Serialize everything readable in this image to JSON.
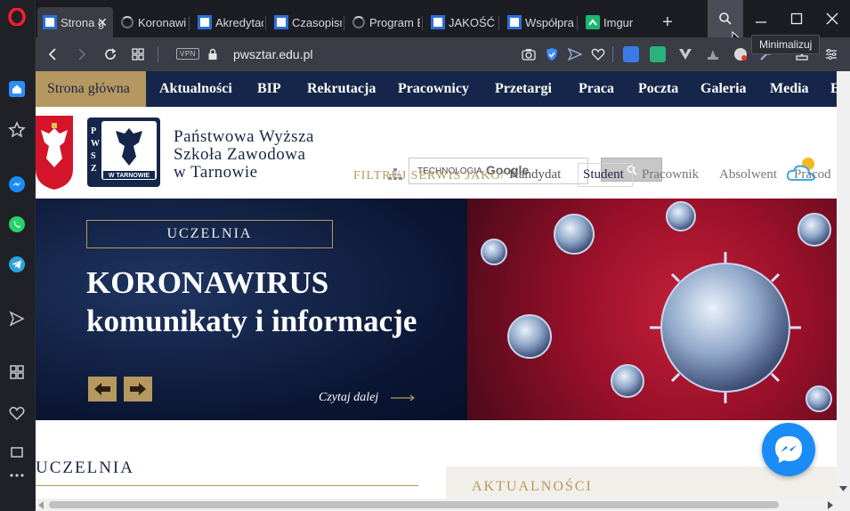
{
  "browser": {
    "tabs": [
      {
        "label": "Strona g",
        "active": true
      },
      {
        "label": "Koronawirus"
      },
      {
        "label": "Akredytac"
      },
      {
        "label": "Czasopism"
      },
      {
        "label": "Program E"
      },
      {
        "label": "JAKOŚĆ K"
      },
      {
        "label": "Współpra"
      },
      {
        "label": "Imgur"
      }
    ],
    "tooltip": "Minimalizuj",
    "vpn_label": "VPN",
    "url": "pwsztar.edu.pl"
  },
  "site": {
    "nav": [
      "Strona główna",
      "Aktualności",
      "BIP",
      "Rekrutacja",
      "Pracownicy",
      "Przetargi",
      "Praca",
      "Poczta",
      "Galeria",
      "Media",
      "E"
    ],
    "logo": {
      "line1": "Państwowa Wyższa",
      "line2": "Szkoła Zawodowa",
      "line3": "w Tarnowie",
      "badge": "W TARNOWIE",
      "letters": "PWSZ"
    },
    "search": {
      "brand": "TECHNOLOGIA",
      "google": "Google"
    },
    "filter": {
      "label": "FILTRUJ SERWIS JAKO/",
      "options": [
        "Kandydat",
        "Student",
        "Pracownik",
        "Absolwent",
        "Pracod"
      ],
      "selected": "Student"
    },
    "hero": {
      "tag": "UCZELNIA",
      "title": "KORONAWIRUS",
      "subtitle": "komunikaty i informacje",
      "read_more": "Czytaj dalej"
    },
    "sections": {
      "uczelnia": "UCZELNIA",
      "aktualnosci": "AKTUALNOŚCI"
    }
  },
  "colors": {
    "navy": "#15264a",
    "gold": "#b5985f",
    "virus_red": "#c4213a"
  }
}
